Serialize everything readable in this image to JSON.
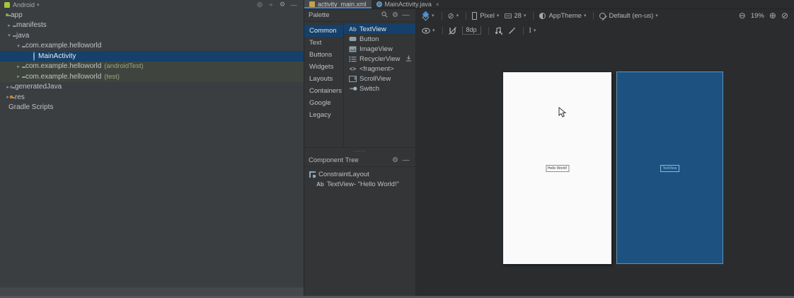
{
  "glyphs": {
    "dropdown": "▾",
    "collapsed": "▸",
    "expanded": "▾",
    "minus": "—",
    "gear": "⚙",
    "target": "◎",
    "collapse_all": "÷",
    "close": "×",
    "search": "⌕",
    "splitter_dots": "·····",
    "zoom_out": "⊖",
    "zoom_in": "⊕",
    "zoom_fit": "⊘",
    "no_zoomable": "⊘",
    "download": "⤓",
    "eye": "◉",
    "magnet": "∪̸",
    "clear_constraints": "♪",
    "infer_constraints": "⟋",
    "align_cursor": "I"
  },
  "projectPanel": {
    "title": "Android",
    "items": [
      {
        "label": "app"
      },
      {
        "label": "manifests"
      },
      {
        "label": "java"
      },
      {
        "label": "com.example.helloworld"
      },
      {
        "label": "MainActivity"
      },
      {
        "label": "com.example.helloworld",
        "suffix": "(androidTest)"
      },
      {
        "label": "com.example.helloworld",
        "suffix": "(test)"
      },
      {
        "label": "generatedJava"
      },
      {
        "label": "res"
      },
      {
        "label": "Gradle Scripts"
      }
    ]
  },
  "tabs": {
    "design_tab": "activity_main.xml",
    "code_tab": "MainActivity.java"
  },
  "palette": {
    "title": "Palette",
    "categories": [
      "Common",
      "Text",
      "Buttons",
      "Widgets",
      "Layouts",
      "Containers",
      "Google",
      "Legacy"
    ],
    "components": [
      {
        "icon_text": "Ab",
        "name": "TextView"
      },
      {
        "name": "Button"
      },
      {
        "name": "ImageView"
      },
      {
        "name": "RecyclerView"
      },
      {
        "icon_text": "<>",
        "name": "<fragment>"
      },
      {
        "name": "ScrollView"
      },
      {
        "name": "Switch"
      }
    ]
  },
  "componentTree": {
    "title": "Component Tree",
    "items": [
      {
        "label": "ConstraintLayout"
      },
      {
        "icon_text": "Ab",
        "label": "TextView- \"Hello World!\""
      }
    ]
  },
  "designToolbar": {
    "device": "Pixel",
    "api_level": "28",
    "theme": "AppTheme",
    "locale": "Default (en-us)",
    "default_margin": "8dp",
    "zoom_level": "19%"
  },
  "canvas": {
    "design_label": "Hello World!",
    "blueprint_label": "TextView"
  },
  "colors": {
    "selection_blue": "#15406b",
    "tab_underline": "#4a88c9",
    "blueprint_blue": "#1d5280",
    "panel_bg": "#3b3e40"
  }
}
